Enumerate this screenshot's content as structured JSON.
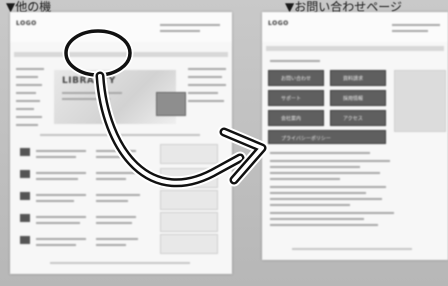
{
  "captions": {
    "left": "▼他の機",
    "right": "▼お問い合わせページ"
  },
  "left_page": {
    "logo": "LOGO",
    "banner": "LIBRAGTY"
  },
  "right_page": {
    "logo": "LOGO",
    "buttons": [
      "お問い合わせ",
      "資料請求",
      "サポート",
      "採用情報",
      "会社案内",
      "アクセス",
      "プライバシーポリシー"
    ]
  },
  "colors": {
    "background": "#bdbdbd",
    "page": "#f7f7f7",
    "arrow": "#111111",
    "arrow_outline": "#ffffff"
  },
  "icons": {
    "magnifier": "magnifier-circle-icon",
    "arrow": "curved-arrow-icon"
  }
}
